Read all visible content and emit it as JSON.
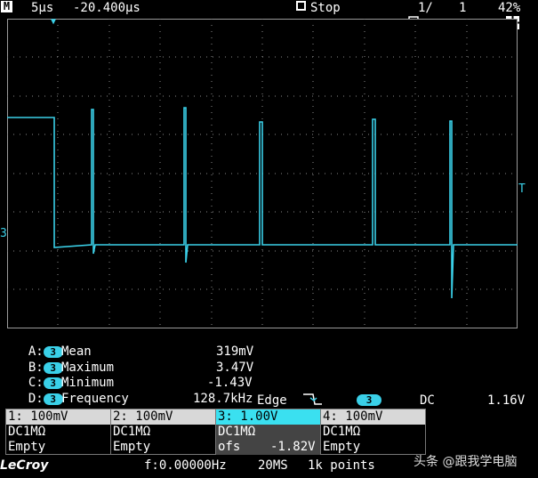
{
  "top": {
    "mode": "M",
    "timebase": "5µs",
    "delay": "-20.400µs",
    "state": "Stop",
    "acq_count": "1/",
    "acq_total": "1",
    "battery": "42%"
  },
  "markers": {
    "trigger_pos": "▼",
    "trigger_level": "T",
    "channel_ref": "3"
  },
  "measurements": [
    {
      "key": "A:",
      "ch": "3",
      "name": "Mean",
      "value": "319mV"
    },
    {
      "key": "B:",
      "ch": "3",
      "name": "Maximum",
      "value": "3.47V"
    },
    {
      "key": "C:",
      "ch": "3",
      "name": "Minimum",
      "value": "-1.43V"
    },
    {
      "key": "D:",
      "ch": "3",
      "name": "Frequency",
      "value": "128.7kHz"
    }
  ],
  "trigger": {
    "type": "Edge",
    "slope_icon": "falling-edge-icon",
    "channel": "3",
    "coupling": "DC",
    "level": "1.16V"
  },
  "channels": [
    {
      "label": "1: 100mV",
      "coupling": "DC1MΩ",
      "offset": "Empty"
    },
    {
      "label": "2: 100mV",
      "coupling": "DC1MΩ",
      "offset": "Empty"
    },
    {
      "label": "3: 1.00V",
      "coupling": "DC1MΩ",
      "offset": "ofs    -1.82V"
    },
    {
      "label": "4: 100mV",
      "coupling": "DC1MΩ",
      "offset": "Empty"
    }
  ],
  "footer": {
    "brand": "LeCroy",
    "frequency": "f:0.00000Hz",
    "sample_rate": "20MS",
    "points": "1k points",
    "watermark": "头条 @跟我学电脑"
  },
  "colors": {
    "trace": "#3ad0e8",
    "grid": "#9a9a9a",
    "header": "#d8d8d8",
    "selected": "#3ae0f0"
  }
}
